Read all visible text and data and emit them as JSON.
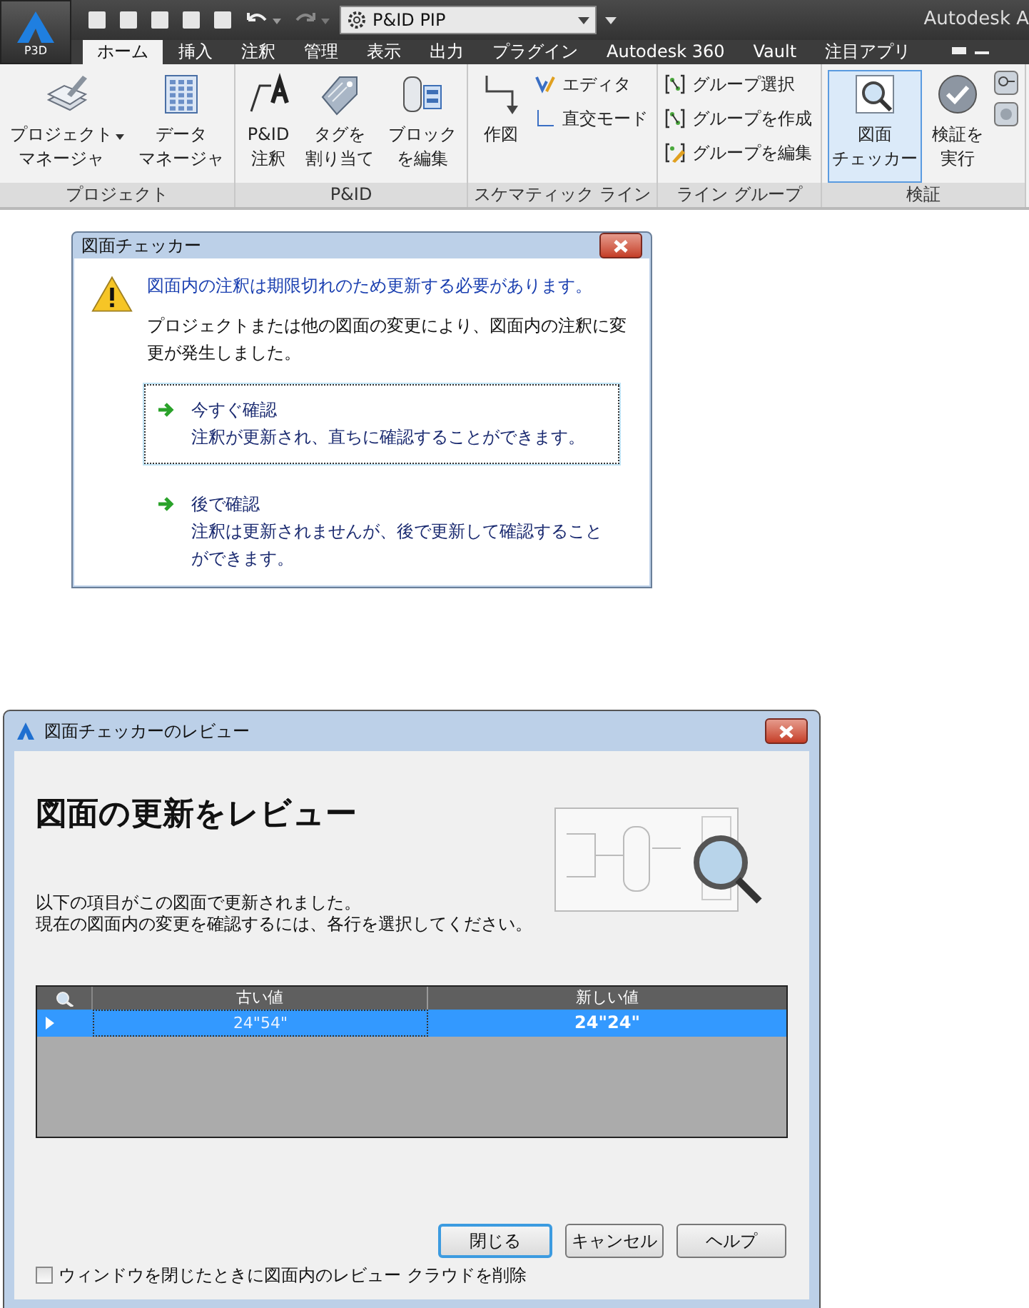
{
  "ribbon": {
    "app_label": "P3D",
    "workspace": "P&ID PIP",
    "title": "Autodesk A",
    "tabs": [
      {
        "label": "ホーム",
        "selected": true
      },
      {
        "label": "挿入",
        "selected": false
      },
      {
        "label": "注釈",
        "selected": false
      },
      {
        "label": "管理",
        "selected": false
      },
      {
        "label": "表示",
        "selected": false
      },
      {
        "label": "出力",
        "selected": false
      },
      {
        "label": "プラグイン",
        "selected": false
      },
      {
        "label": "Autodesk 360",
        "selected": false
      },
      {
        "label": "Vault",
        "selected": false
      },
      {
        "label": "注目アプリ",
        "selected": false
      }
    ],
    "panels": [
      {
        "title": "プロジェクト",
        "tools": [
          {
            "kind": "large",
            "lines": [
              "プロジェクト",
              "マネージャ"
            ],
            "dropdown": true,
            "selected": false
          },
          {
            "kind": "large",
            "lines": [
              "データ",
              "マネージャ"
            ],
            "dropdown": false,
            "selected": false
          }
        ]
      },
      {
        "title": "P&ID",
        "tools": [
          {
            "kind": "large",
            "lines": [
              "P&ID",
              "注釈"
            ],
            "dropdown": false,
            "selected": false
          },
          {
            "kind": "large",
            "lines": [
              "タグを",
              "割り当て"
            ],
            "dropdown": false,
            "selected": false
          },
          {
            "kind": "large",
            "lines": [
              "ブロック",
              "を編集"
            ],
            "dropdown": false,
            "selected": false
          }
        ]
      },
      {
        "title": "スケマティック ライン",
        "tools": [
          {
            "kind": "large",
            "lines": [
              "作図"
            ],
            "dropdown": false,
            "selected": false
          },
          {
            "kind": "small",
            "lines": [
              "エディタ"
            ]
          },
          {
            "kind": "small",
            "lines": [
              "直交モード"
            ]
          }
        ]
      },
      {
        "title": "ライン グループ",
        "tools": [
          {
            "kind": "small",
            "lines": [
              "グループ選択"
            ]
          },
          {
            "kind": "small",
            "lines": [
              "グループを作成"
            ]
          },
          {
            "kind": "small",
            "lines": [
              "グループを編集"
            ]
          }
        ]
      },
      {
        "title": "検証",
        "tools": [
          {
            "kind": "large",
            "lines": [
              "図面",
              "チェッカー"
            ],
            "dropdown": false,
            "selected": true
          },
          {
            "kind": "large",
            "lines": [
              "検証を",
              "実行"
            ],
            "dropdown": false,
            "selected": false
          }
        ]
      }
    ]
  },
  "checker_dialog": {
    "title": "図面チェッカー",
    "message": "図面内の注釈は期限切れのため更新する必要があります。",
    "detail": "プロジェクトまたは他の図面の変更により、図面内の注釈に変更が発生しました。",
    "options": [
      {
        "title": "今すぐ確認",
        "description": "注釈が更新され、直ちに確認することができます。",
        "focused": true
      },
      {
        "title": "後で確認",
        "description": "注釈は更新されませんが、後で更新して確認することができます。",
        "focused": false
      }
    ]
  },
  "review_dialog": {
    "title": "図面チェッカーのレビュー",
    "heading": "図面の更新をレビュー",
    "description": [
      "以下の項目がこの図面で更新されました。",
      "現在の図面内の変更を確認するには、各行を選択してください。"
    ],
    "table": {
      "columns": [
        "古い値",
        "新しい値"
      ],
      "rows": [
        {
          "old": "24\"54\"",
          "new": "24\"24\"",
          "selected": true
        }
      ]
    },
    "buttons": [
      {
        "label": "閉じる",
        "default": true
      },
      {
        "label": "キャンセル",
        "default": false
      },
      {
        "label": "ヘルプ",
        "default": false
      }
    ],
    "checkbox": {
      "label": "ウィンドウを閉じたときに図面内のレビュー クラウドを削除",
      "checked": false
    }
  }
}
